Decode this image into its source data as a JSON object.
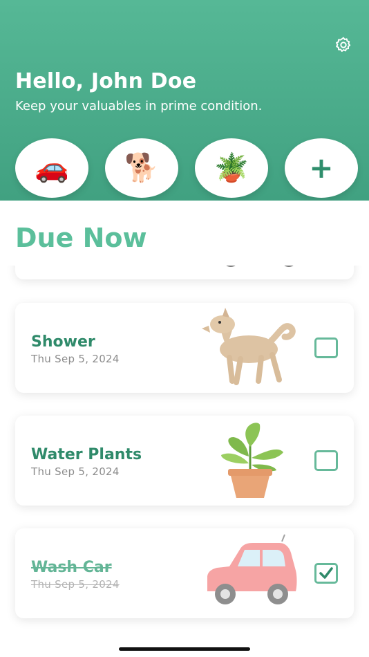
{
  "header": {
    "greeting": "Hello, John Doe",
    "subtitle": "Keep your valuables in prime condition.",
    "settings_icon": "gear-icon",
    "categories": [
      {
        "name": "car",
        "emoji": "🚗"
      },
      {
        "name": "dog",
        "emoji": "🐕"
      },
      {
        "name": "plant",
        "emoji": "🪴"
      },
      {
        "name": "add",
        "label": "+"
      }
    ]
  },
  "main": {
    "section_title": "Due Now",
    "tasks": [
      {
        "title": "Shower",
        "date": "Thu Sep 5, 2024",
        "icon": "dog-icon",
        "checked": false
      },
      {
        "title": "Water Plants",
        "date": "Thu Sep 5, 2024",
        "icon": "plant-icon",
        "checked": false
      },
      {
        "title": "Wash Car",
        "date": "Thu Sep 5, 2024",
        "icon": "car-icon",
        "checked": true
      }
    ]
  },
  "colors": {
    "accent": "#4cae8c",
    "accent_dark": "#2f8a6a",
    "accent_light": "#5bbf9b"
  }
}
